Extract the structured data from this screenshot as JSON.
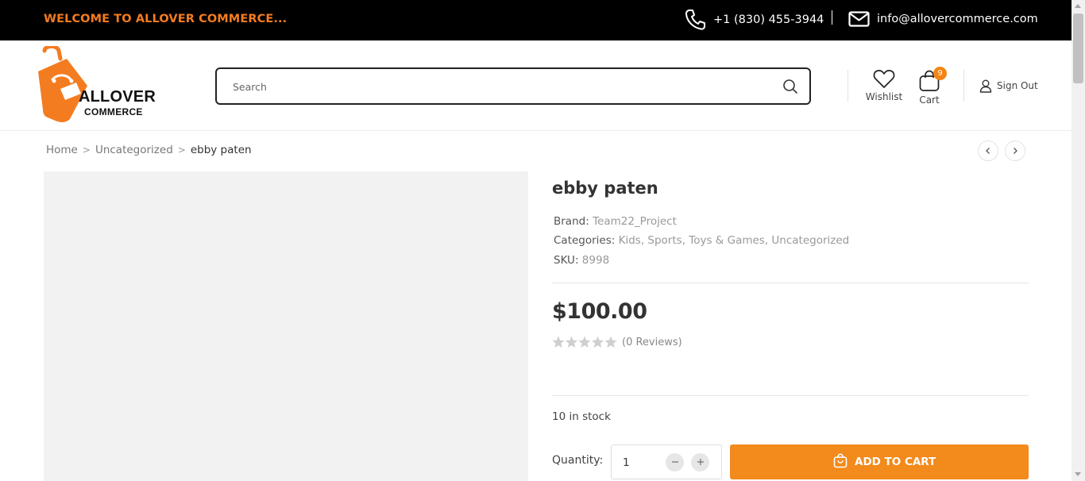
{
  "topbar": {
    "welcome": "WELCOME TO ALLOVER COMMERCE...",
    "phone": "+1 (830) 455-3944",
    "email": "info@allovercommerce.com"
  },
  "header": {
    "logo_line1": "ALLOVER",
    "logo_line2": "COMMERCE",
    "search_placeholder": "Search",
    "wishlist_label": "Wishlist",
    "cart_label": "Cart",
    "cart_count": "9",
    "signout_label": "Sign Out"
  },
  "breadcrumb": {
    "home": "Home",
    "category": "Uncategorized",
    "current": "ebby paten",
    "separator": ">"
  },
  "product": {
    "title": "ebby paten",
    "brand_label": "Brand:",
    "brand_value": "Team22_Project",
    "categories_label": "Categories:",
    "categories_value": "Kids, Sports, Toys & Games, Uncategorized",
    "sku_label": "SKU:",
    "sku_value": "8998",
    "price": "$100.00",
    "rating": 0,
    "rating_max": 5,
    "reviews": "(0 Reviews)",
    "stock": "10 in stock",
    "quantity_label": "Quantity:",
    "quantity_value": "1",
    "add_to_cart_label": "ADD TO CART"
  },
  "colors": {
    "accent": "#f28a1c",
    "topbar_bg": "#000000",
    "image_placeholder": "#f2f2f2"
  }
}
